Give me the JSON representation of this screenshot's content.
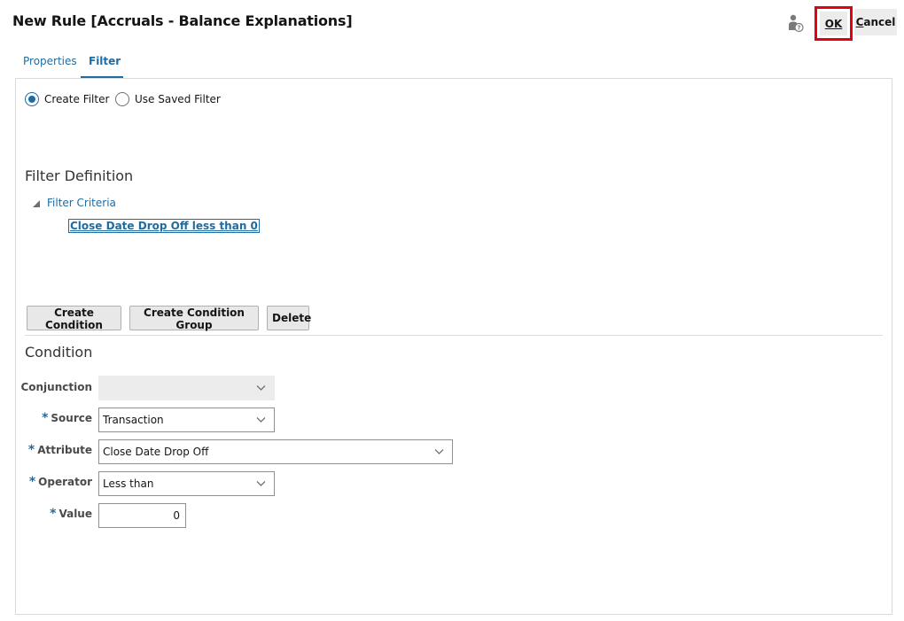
{
  "header": {
    "title": "New Rule [Accruals - Balance Explanations]",
    "ok_label": "OK",
    "cancel_first": "C",
    "cancel_rest": "ancel"
  },
  "tabs": [
    {
      "label": "Properties",
      "selected": false
    },
    {
      "label": "Filter",
      "selected": true
    }
  ],
  "filter_mode": {
    "options": [
      {
        "label": "Create Filter",
        "selected": true
      },
      {
        "label": "Use Saved Filter",
        "selected": false
      }
    ]
  },
  "filter_definition": {
    "title": "Filter Definition",
    "criteria_label": "Filter Criteria",
    "conditions": [
      "Close Date Drop Off less than 0"
    ]
  },
  "actions": {
    "create_condition": "Create Condition",
    "create_condition_group": "Create Condition Group",
    "delete": "Delete"
  },
  "condition": {
    "title": "Condition",
    "conjunction": {
      "label": "Conjunction",
      "value": ""
    },
    "source": {
      "label": "Source",
      "value": "Transaction",
      "required": true
    },
    "attribute": {
      "label": "Attribute",
      "value": "Close Date Drop Off",
      "required": true
    },
    "operator": {
      "label": "Operator",
      "value": "Less than",
      "required": true
    },
    "value": {
      "label": "Value",
      "value": "0",
      "required": true
    }
  },
  "colors": {
    "accent": "#1e6ca3",
    "highlight_border": "#e3000f"
  }
}
